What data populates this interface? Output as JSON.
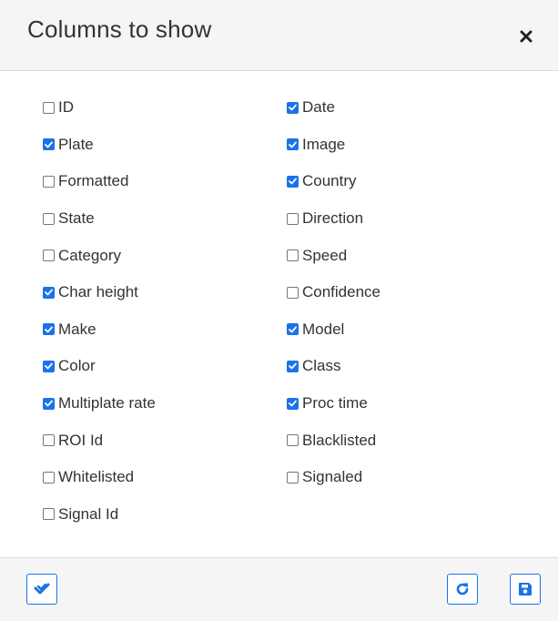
{
  "dialog": {
    "title": "Columns to show"
  },
  "columns_left": [
    {
      "label": "ID",
      "checked": false
    },
    {
      "label": "Plate",
      "checked": true
    },
    {
      "label": "Formatted",
      "checked": false
    },
    {
      "label": "State",
      "checked": false
    },
    {
      "label": "Category",
      "checked": false
    },
    {
      "label": "Char height",
      "checked": true
    },
    {
      "label": "Make",
      "checked": true
    },
    {
      "label": "Color",
      "checked": true
    },
    {
      "label": "Multiplate rate",
      "checked": true
    },
    {
      "label": "ROI Id",
      "checked": false
    },
    {
      "label": "Whitelisted",
      "checked": false
    },
    {
      "label": "Signal Id",
      "checked": false
    }
  ],
  "columns_right": [
    {
      "label": "Date",
      "checked": true
    },
    {
      "label": "Image",
      "checked": true
    },
    {
      "label": "Country",
      "checked": true
    },
    {
      "label": "Direction",
      "checked": false
    },
    {
      "label": "Speed",
      "checked": false
    },
    {
      "label": "Confidence",
      "checked": false
    },
    {
      "label": "Model",
      "checked": true
    },
    {
      "label": "Class",
      "checked": true
    },
    {
      "label": "Proc time",
      "checked": true
    },
    {
      "label": "Blacklisted",
      "checked": false
    },
    {
      "label": "Signaled",
      "checked": false
    }
  ],
  "icons": {
    "close": "close-icon",
    "select_all": "double-check-icon",
    "reset": "redo-icon",
    "save": "floppy-disk-icon"
  },
  "colors": {
    "accent": "#1a73e8",
    "header_bg": "#f5f5f5",
    "text": "#333333"
  }
}
